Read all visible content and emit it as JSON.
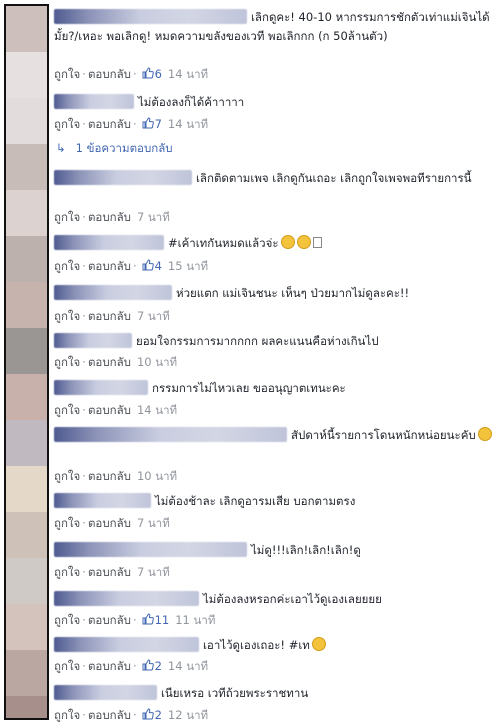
{
  "actions": {
    "like": "ถูกใจ",
    "reply": "ตอบกลับ",
    "separator": "·"
  },
  "reply_link": "1 ข้อความตอบกลับ",
  "colors": {
    "link_blue": "#4267b2",
    "meta_gray": "#90949c",
    "text": "#1d2129"
  },
  "comments": [
    {
      "text": "เลิกดูคะ! 40-10 หากรรมการชักตัวเท่าแม่เจินได้มั้ย?/เหอะ พอเลิกดู! หมดความขลังของเวที พอเลิกกก (ก 50ล้านตัว)",
      "likes": "6",
      "time": "14 นาที"
    },
    {
      "text": "ไม่ต้องลงก็ได้ค้าาาาา",
      "likes": "7",
      "time": "14 นาที"
    },
    {
      "text": "เลิกติดตามเพจ เลิกดูกันเถอะ เลิกถูกใจเพจพอทีรายการนี้",
      "likes": "",
      "time": "7 นาที"
    },
    {
      "text": "#เค้าเทกันหมดแล้วจ่ะ",
      "likes": "4",
      "time": "15 นาที"
    },
    {
      "text": "ห่วยแตก แม่เจินชนะ เห็นๆ ป่วยมากไม่ดูละคะ!!",
      "likes": "",
      "time": "7 นาที"
    },
    {
      "text": "ยอมใจกรรมการมากกกก ผลคะแนนคือห่างเกินไป",
      "likes": "",
      "time": "10 นาที"
    },
    {
      "text": "กรรมการไม่ไหวเลย ขออนุญาตเทนะคะ",
      "likes": "",
      "time": "14 นาที"
    },
    {
      "text": "สัปดาห์นี้รายการโดนหนักหน่อยนะคับ",
      "likes": "",
      "time": "10 นาที"
    },
    {
      "text": "ไม่ต้องช้าละ เลิกดูอารมเสีย บอกตามตรง",
      "likes": "",
      "time": "7 นาที"
    },
    {
      "text": "ไม่ดู!!!เลิก!เลิก!เลิก!ดู",
      "likes": "",
      "time": "7 นาที"
    },
    {
      "text": "ไม่ต้องลงหรอกค่ะเอาไว้ดูเองเลยยยย",
      "likes": "11",
      "time": "11 นาที"
    },
    {
      "text": "เอาไว้ดูเองเถอะ! #เท",
      "likes": "2",
      "time": "14 นาที"
    },
    {
      "text": "เนียเหรอ เวทีถ้วยพระราชทาน",
      "likes": "2",
      "time": "12 นาที"
    }
  ]
}
